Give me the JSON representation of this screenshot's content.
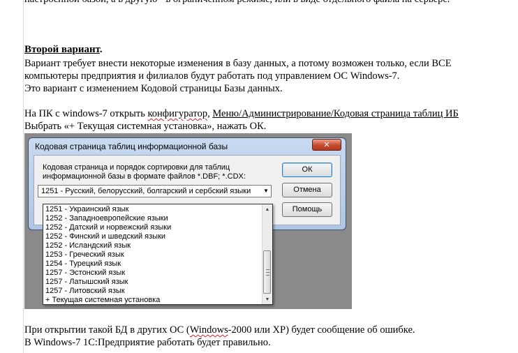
{
  "document": {
    "cut_line": "настроенной базой, а в другую - в ограниченном режиме, или в виде отдельного файла на сервере.",
    "heading": "Второй вариант",
    "heading_dot": ".",
    "para1": "Вариант требует внести некоторые изменения в базу данных, а потому возможен только, если ВСЕ",
    "para2": "компьютеры предприятия и филиалов будут работать под управлением ОС Windows-7.",
    "para3": "Это вариант с изменением Кодовой страницы Базы данных.",
    "para4_prefix": "На ПК с windows-7 открыть ",
    "para4_link1": "конфигуратор",
    "para4_sep": ", ",
    "para4_link2": "Меню/Администрирование/Кодовая страница таблиц ИБ",
    "para5": "Выбрать «+ Текущая системная установка», нажать ОК.",
    "para6_prefix": "При открытии такой БД в других ОС (",
    "para6_link": "Windows",
    "para6_suffix": "-2000 или ХР) будет сообщение об ошибке.",
    "para7": "В Windows-7 1С:Предприятие работать будет правильно."
  },
  "dialog": {
    "title": "Кодовая страница таблиц информационной базы",
    "close_symbol": "✕",
    "description_line1": "Кодовая страница и порядок сортировки для таблиц",
    "description_line2": "информационной базы в формате файлов *.DBF; *.CDX:",
    "combo_value": "1251 - Русский, белорусский, болгарский и сербский языки",
    "ok_label": "ОК",
    "cancel_label": "Отмена",
    "help_label": "Помощь",
    "dropdown_items": [
      "1251 - Украинский язык",
      "1252 - Западноевропейские языки",
      "1252 - Датский и норвежский языки",
      "1252 - Финский и шведский языки",
      "1252 - Исландский язык",
      "1253 - Греческий язык",
      "1254 - Турецкий язык",
      "1257 - Эстонский язык",
      "1257 - Латышский язык",
      "1257 - Литовский язык",
      "+ Текущая системная установка"
    ]
  },
  "icons": {
    "combo_arrow": "chevron-down-icon",
    "scroll_up": "arrow-up-icon",
    "scroll_down": "arrow-down-icon",
    "close": "close-icon"
  }
}
